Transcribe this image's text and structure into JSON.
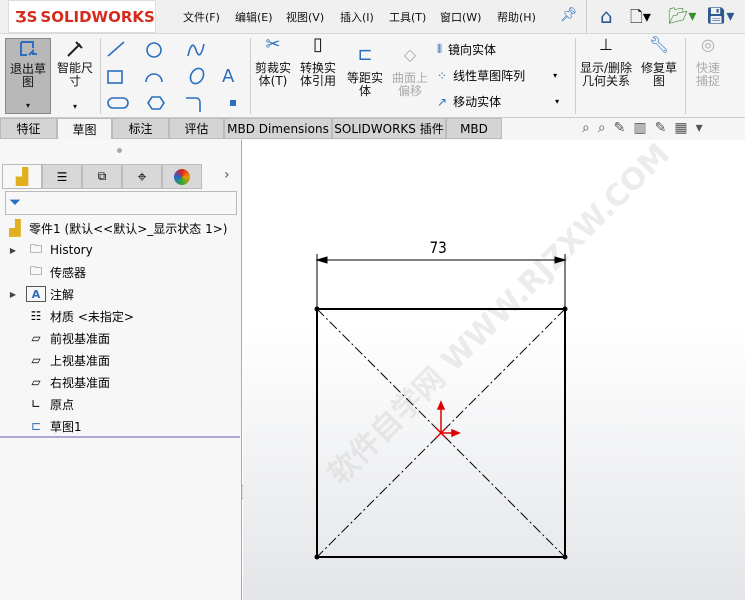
{
  "app": {
    "logo": "SOLIDWORKS"
  },
  "menu": [
    "文件(F)",
    "编辑(E)",
    "视图(V)",
    "插入(I)",
    "工具(T)",
    "窗口(W)",
    "帮助(H)"
  ],
  "ribbon": {
    "exit_sketch": "退出草图",
    "smart_dim": "智能尺寸",
    "trim": "剪裁实体(T)",
    "convert": "转换实体引用",
    "offset": "等距实体",
    "surface_offset": "曲面上偏移",
    "mirror": "镜向实体",
    "linear_pattern": "线性草图阵列",
    "move": "移动实体",
    "relations": "显示/删除几何关系",
    "repair": "修复草图",
    "quick_snap": "快速捕捉"
  },
  "tabs": [
    "特征",
    "草图",
    "标注",
    "评估",
    "MBD Dimensions",
    "SOLIDWORKS 插件",
    "MBD"
  ],
  "active_tab": 1,
  "tree": {
    "root": "零件1  (默认<<默认>_显示状态 1>)",
    "items": [
      {
        "label": "History",
        "expandable": true
      },
      {
        "label": "传感器",
        "expandable": false
      },
      {
        "label": "注解",
        "expandable": true
      },
      {
        "label": "材质 <未指定>",
        "expandable": false
      },
      {
        "label": "前视基准面",
        "expandable": false
      },
      {
        "label": "上视基准面",
        "expandable": false
      },
      {
        "label": "右视基准面",
        "expandable": false
      },
      {
        "label": "原点",
        "expandable": false
      },
      {
        "label": "草图1",
        "expandable": false
      }
    ]
  },
  "sketch": {
    "dimension": "73",
    "watermark": "软件自学网 WWW.RJZXW.COM"
  },
  "colors": {
    "accent": "#d52b1e",
    "origin": "#e00000",
    "tree_sep": "#b0a8d0"
  }
}
